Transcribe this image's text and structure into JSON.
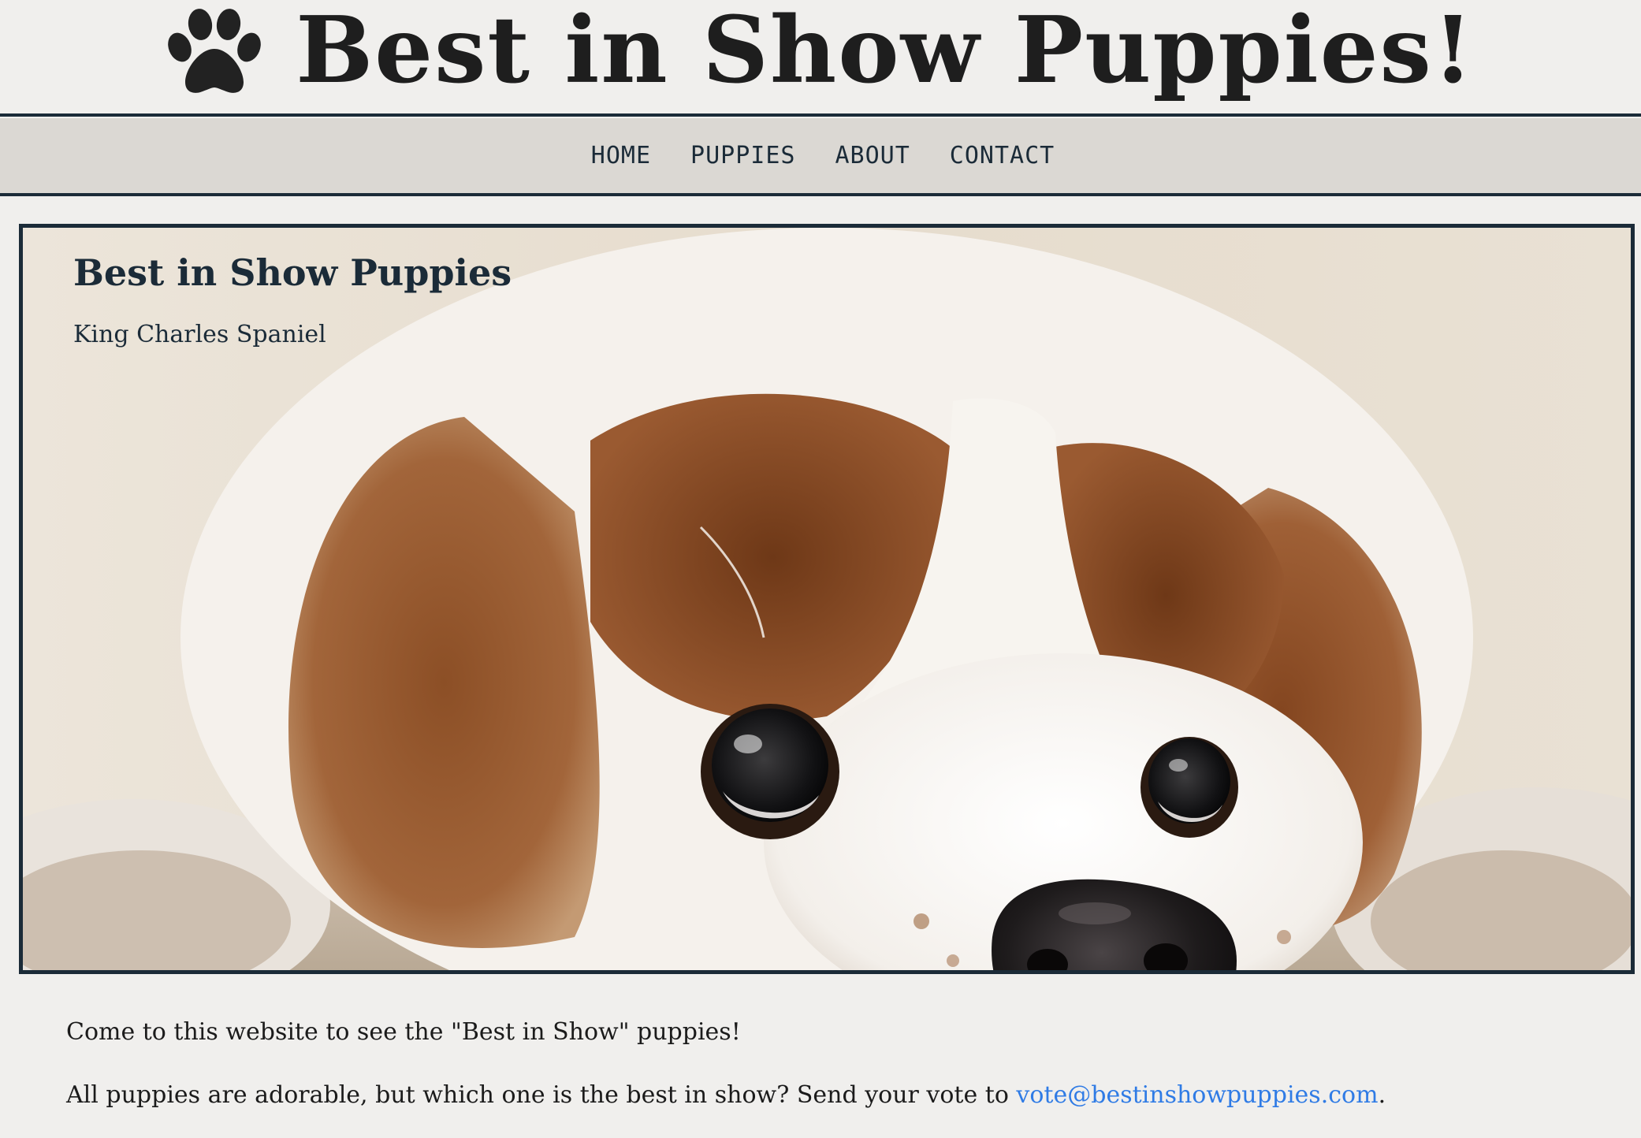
{
  "header": {
    "logo_icon": "paw-print-icon",
    "title": "Best in Show Puppies!"
  },
  "nav": {
    "items": [
      {
        "label": "HOME"
      },
      {
        "label": "PUPPIES"
      },
      {
        "label": "ABOUT"
      },
      {
        "label": "CONTACT"
      }
    ]
  },
  "hero": {
    "title": "Best in Show Puppies",
    "subtitle": "King Charles Spaniel"
  },
  "intro": {
    "line1": "Come to this website to see the \"Best in Show\" puppies!",
    "line2_before": "All puppies are adorable, but which one is the best in show? Send your vote to ",
    "email": "vote@bestinshowpuppies.com",
    "line2_after": "."
  },
  "colors": {
    "background": "#f0efed",
    "nav_background": "#dbd8d3",
    "border": "#1b2b38",
    "link": "#2f7be5"
  }
}
